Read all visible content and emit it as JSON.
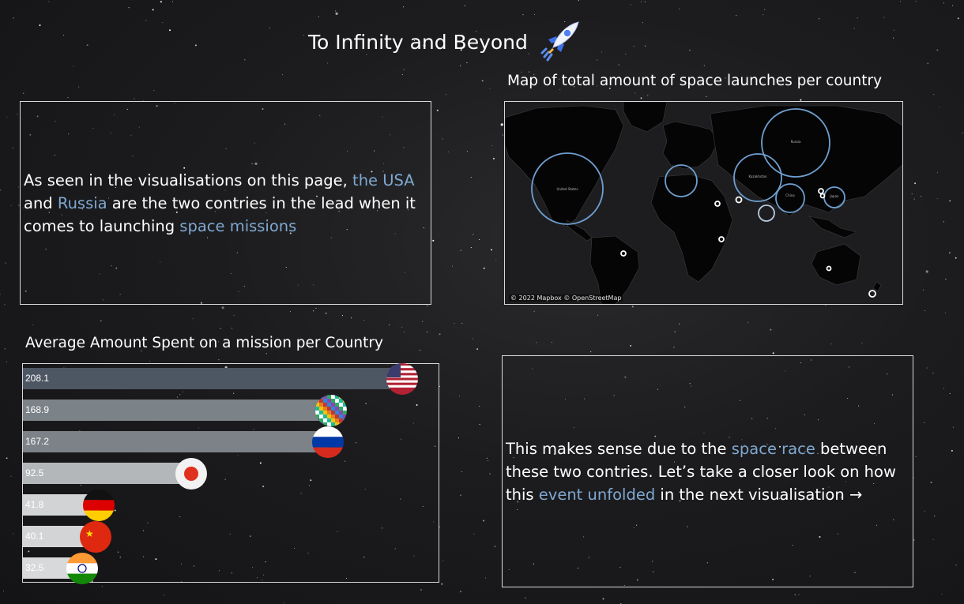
{
  "page": {
    "title": "To Infinity and Beyond",
    "title_icon": "rocket-icon"
  },
  "left_panel": {
    "parts": [
      "As seen in the visualisations on this page, ",
      "the USA",
      " and ",
      "Russia",
      " are the two contries in the lead when it comes to launching ",
      "space missions",
      ""
    ]
  },
  "map": {
    "title": "Map of total amount of space launches per country",
    "credit": "© 2022 Mapbox © OpenStreetMap",
    "labels": {
      "usa": "United States",
      "russia": "Russia",
      "kazakhstan": "Kazakhstan",
      "china": "China",
      "japan": "Japan"
    }
  },
  "bar_chart": {
    "title": "Average Amount  Spent on a mission per  Country"
  },
  "chart_data": {
    "type": "bar",
    "title": "Average Amount  Spent on a mission per  Country",
    "orientation": "horizontal",
    "categories": [
      "USA",
      "World",
      "Russia",
      "Japan",
      "Germany",
      "China",
      "India"
    ],
    "values": [
      208.1,
      168.9,
      167.2,
      92.5,
      41.8,
      40.1,
      32.5
    ],
    "labels": [
      "208.1",
      "168.9",
      "167.2",
      "92.5",
      "41.8",
      "40.1",
      "32.5"
    ],
    "icons": [
      "usa-flag-icon",
      "world-flags-icon",
      "russia-flag-icon",
      "japan-flag-icon",
      "germany-flag-icon",
      "china-flag-icon",
      "india-flag-icon"
    ],
    "colors": [
      "#4d5663",
      "#7b8288",
      "#7c8287",
      "#b4b7ba",
      "#d2d3d5",
      "#d3d4d6",
      "#d8d9da"
    ],
    "xlim": [
      0,
      208.1
    ],
    "grid": false
  },
  "right_panel": {
    "parts": [
      "This makes sense due to the ",
      "space race",
      " between these two contries. Let’s take a closer look on how this ",
      "event unfolded",
      " in the next visualisation →"
    ]
  },
  "colors": {
    "background": "#1c1c1e",
    "highlight": "#7fa8d1",
    "border": "#d9d9d9",
    "bubble_stroke": "#6f9fd1"
  }
}
